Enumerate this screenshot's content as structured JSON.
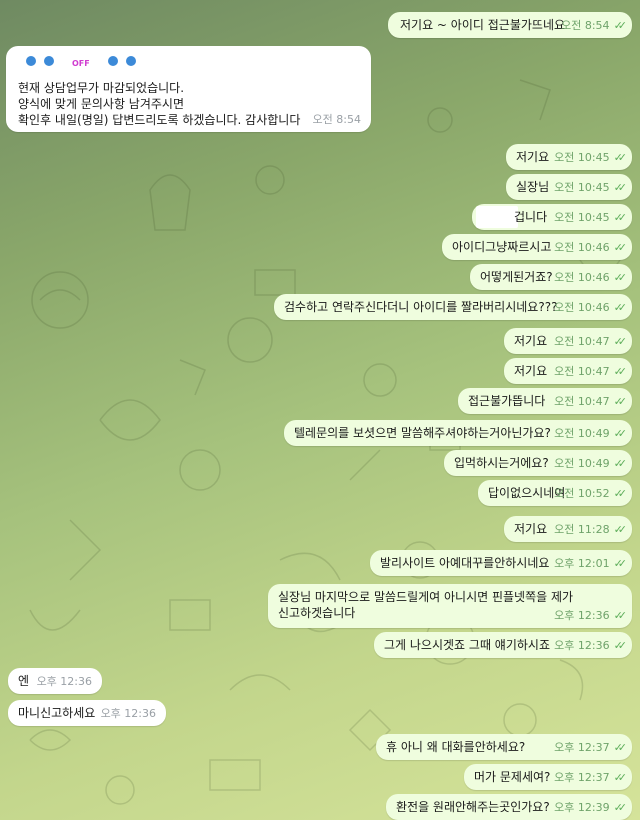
{
  "chat": {
    "colors": {
      "outgoing_bubble": "#effdde",
      "incoming_bubble": "#ffffff",
      "time_text": "#6fa36a",
      "check": "#5eae5a"
    },
    "notice": {
      "badge": "OFF",
      "lines": [
        "현재 상담업무가 마감되었습니다.",
        "양식에 맞게 문의사항 남겨주시면",
        "확인후 내일(명일) 답변드리도록 하겠습니다. 감사합니다"
      ],
      "time": "오전 8:54"
    },
    "messages": [
      {
        "text": "저기요 ~ 아이디 접근불가뜨네요",
        "time": "오전 8:54"
      },
      {
        "text": "저기요",
        "time": "오전 10:45"
      },
      {
        "text": "실장님",
        "time": "오전 10:45"
      },
      {
        "text": "겁니다",
        "time": "오전 10:45"
      },
      {
        "text": "아이디그냥짜르시고",
        "time": "오전 10:46"
      },
      {
        "text": "어떻게된거죠?",
        "time": "오전 10:46"
      },
      {
        "text": "검수하고 연락주신다더니 아이디를 짤라버리시네요???",
        "time": "오전 10:46"
      },
      {
        "text": "저기요",
        "time": "오전 10:47"
      },
      {
        "text": "저기요",
        "time": "오전 10:47"
      },
      {
        "text": "접근불가뜹니다",
        "time": "오전 10:47"
      },
      {
        "text": "텔레문의를 보셧으면 말씀해주셔야하는거아닌가요?",
        "time": "오전 10:49"
      },
      {
        "text": "입먹하시는거에요?",
        "time": "오전 10:49"
      },
      {
        "text": "답이없으시네여",
        "time": "오전 10:52"
      },
      {
        "text": "저기요",
        "time": "오전 11:28"
      },
      {
        "text": "발리사이트 아예대꾸를안하시네요",
        "time": "오후 12:01"
      },
      {
        "text": "실장님 마지막으로 말씀드릴게여 아니시면 핀플넷쪽을 제가",
        "text2": "신고하겟습니다",
        "time": "오후 12:36"
      },
      {
        "text": "그게 나으시겟죠 그때 얘기하시죠",
        "time": "오후 12:36"
      },
      {
        "text": "휴 아니 왜 대화를안하세요?",
        "time": "오후 12:37"
      },
      {
        "text": "머가 문제세여?",
        "time": "오후 12:37"
      },
      {
        "text": "환전을 원래안해주는곳인가요?",
        "time": "오후 12:39"
      }
    ],
    "replies": [
      {
        "text": "엔",
        "time": "오후 12:36"
      },
      {
        "text": "마니신고하세요",
        "time": "오후 12:36"
      }
    ]
  }
}
